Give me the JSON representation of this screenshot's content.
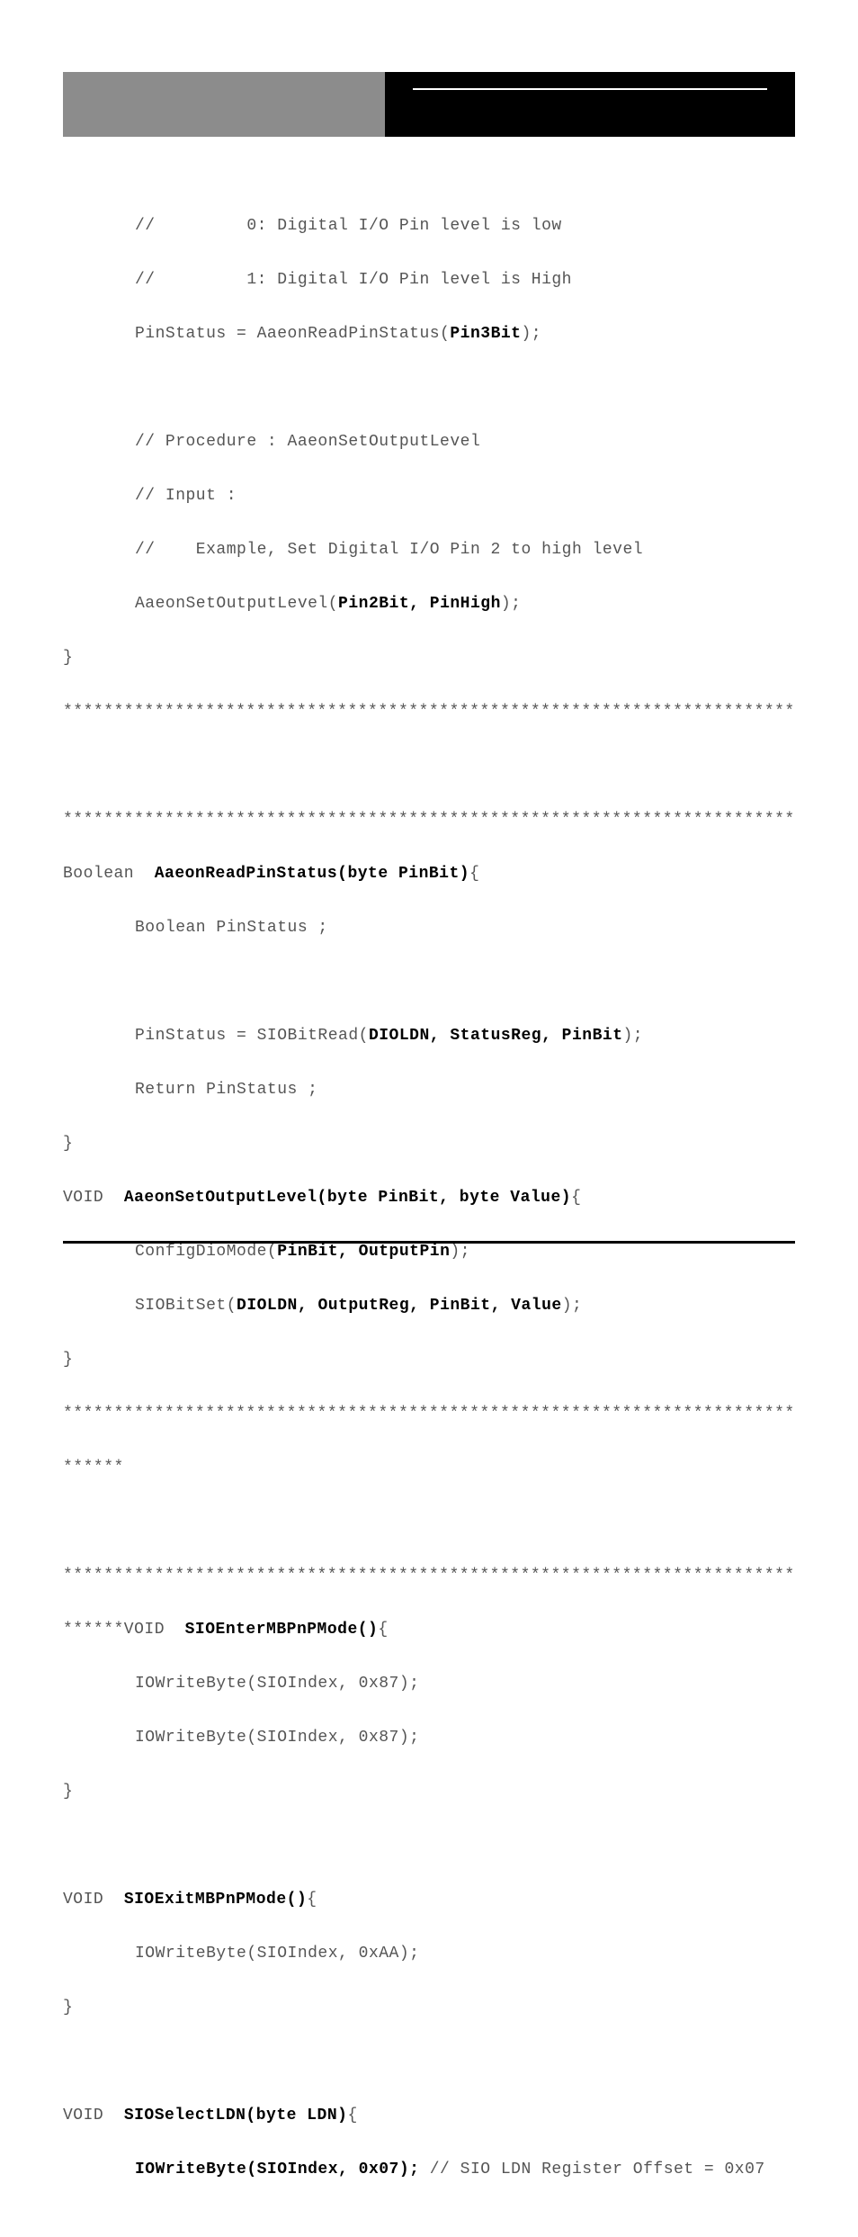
{
  "code": {
    "l01": "//         0: Digital I/O Pin level is low",
    "l02": "//         1: Digital I/O Pin level is High",
    "l03a": "PinStatus = AaeonReadPinStatus(",
    "l03b": "Pin3Bit",
    "l03c": ");",
    "l04": "",
    "l05": "// Procedure : AaeonSetOutputLevel",
    "l06": "// Input :",
    "l07": "//    Example, Set Digital I/O Pin 2 to high level",
    "l08a": "AaeonSetOutputLevel(",
    "l08b": "Pin2Bit, PinHigh",
    "l08c": ");",
    "l09": "}",
    "l10": "************************************************************************",
    "l11": "",
    "l12": "************************************************************************",
    "l13a": "Boolean  ",
    "l13b": "AaeonReadPinStatus(byte PinBit)",
    "l13c": "{",
    "l14": "Boolean PinStatus ;",
    "l15": "",
    "l16a": "PinStatus = SIOBitRead(",
    "l16b": "DIOLDN, StatusReg, PinBit",
    "l16c": ");",
    "l17": "Return PinStatus ;",
    "l18": "}",
    "l19a": "VOID  ",
    "l19b": "AaeonSetOutputLevel(byte PinBit, byte Value)",
    "l19c": "{",
    "l20a": "ConfigDioMode(",
    "l20b": "PinBit, OutputPin",
    "l20c": ");",
    "l21a": "SIOBitSet(",
    "l21b": "DIOLDN, OutputReg, PinBit, Value",
    "l21c": ");",
    "l22": "}",
    "l23": "************************************************************************",
    "l24": "******",
    "l25": "",
    "l26": "************************************************************************",
    "l27a": "******VOID  ",
    "l27b": "SIOEnterMBPnPMode()",
    "l27c": "{",
    "l28": "IOWriteByte(SIOIndex, 0x87);",
    "l29": "IOWriteByte(SIOIndex, 0x87);",
    "l30": "}",
    "l31": "",
    "l32a": "VOID  ",
    "l32b": "SIOExitMBPnPMode()",
    "l32c": "{",
    "l33": "IOWriteByte(SIOIndex, 0xAA);",
    "l34": "}",
    "l35": "",
    "l36a": "VOID  ",
    "l36b": "SIOSelectLDN(byte LDN)",
    "l36c": "{",
    "l37a": "IOWriteByte(SIOIndex, 0x07);",
    "l37b": " // SIO LDN Register Offset = 0x07"
  }
}
